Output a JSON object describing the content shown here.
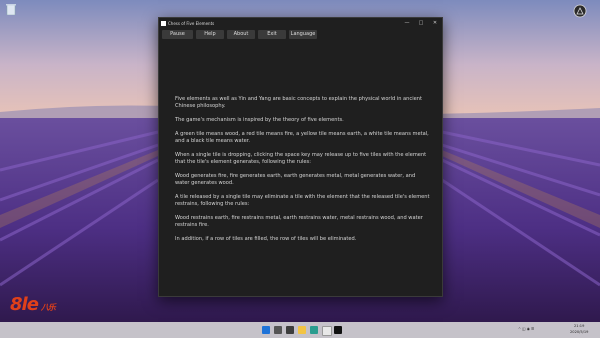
{
  "window": {
    "title": "Chess of Five Elements",
    "controls": {
      "minimize": "—",
      "maximize": "□",
      "close": "✕"
    }
  },
  "menu": [
    {
      "label": "Pause"
    },
    {
      "label": "Help"
    },
    {
      "label": "About"
    },
    {
      "label": "Exit"
    },
    {
      "label": "Language"
    }
  ],
  "content": {
    "paragraphs": [
      "Five elements as well as Yin and Yang are basic concepts to explain the physical world in ancient Chinese philosophy.",
      "The game's mechanism is inspired by the theory of five elements.",
      "A green tile means wood, a red tile means fire, a yellow tile means earth, a white tile means metal, and a black tile means water.",
      "When a single tile is dropping, clicking the space key may release up to five tiles with the element that the tile's element generates, following the rules:",
      "Wood generates fire, fire generates earth, earth generates metal, metal generates water, and water generates wood.",
      "A tile released by a single tile may eliminate a tile with the element that the released tile's element restrains, following the rules:",
      "Wood restrains earth, fire restrains metal, earth restrains water, metal restrains wood, and water restrains fire.",
      "In addition, if a row of tiles are filled, the row of tiles will be eliminated."
    ]
  },
  "desktop": {
    "icons": [
      {
        "name": "recycle-bin-icon"
      },
      {
        "name": "app-shortcut-icon"
      }
    ],
    "watermark": {
      "main": "8le",
      "sub": "八乐"
    }
  },
  "taskbar": {
    "tray_time": "21:19",
    "tray_date": "2020/5/19"
  },
  "colors": {
    "window_bg": "#1f1f1f",
    "button_bg": "#3a3a3a",
    "text": "#d6d6d6",
    "watermark": "#e0401a"
  }
}
